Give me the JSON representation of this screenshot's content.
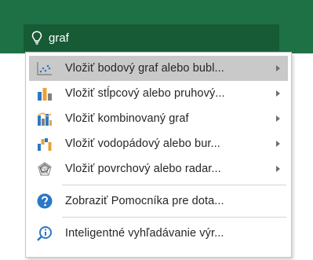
{
  "search": {
    "value": "graf"
  },
  "menu": {
    "items": [
      {
        "label": "Vložiť bodový graf alebo bubl...",
        "icon": "scatter-chart-icon",
        "submenu": true,
        "selected": true
      },
      {
        "label": "Vložiť stĺpcový alebo pruhový...",
        "icon": "column-chart-icon",
        "submenu": true
      },
      {
        "label": "Vložiť kombinovaný graf",
        "icon": "combo-chart-icon",
        "submenu": true
      },
      {
        "label": "Vložiť vodopádový alebo bur...",
        "icon": "waterfall-chart-icon",
        "submenu": true
      },
      {
        "label": "Vložiť povrchový alebo radar...",
        "icon": "radar-chart-icon",
        "submenu": true
      }
    ],
    "help_items": [
      {
        "label": "Zobraziť Pomocníka pre dota...",
        "icon": "help-icon"
      },
      {
        "label": "Inteligentné vyhľadávanie výr...",
        "icon": "smart-lookup-icon"
      }
    ]
  },
  "colors": {
    "ribbon": "#1e7145",
    "search_bg": "#165b36",
    "selected_bg": "#c9c9c9",
    "help_blue": "#2b78c5"
  }
}
